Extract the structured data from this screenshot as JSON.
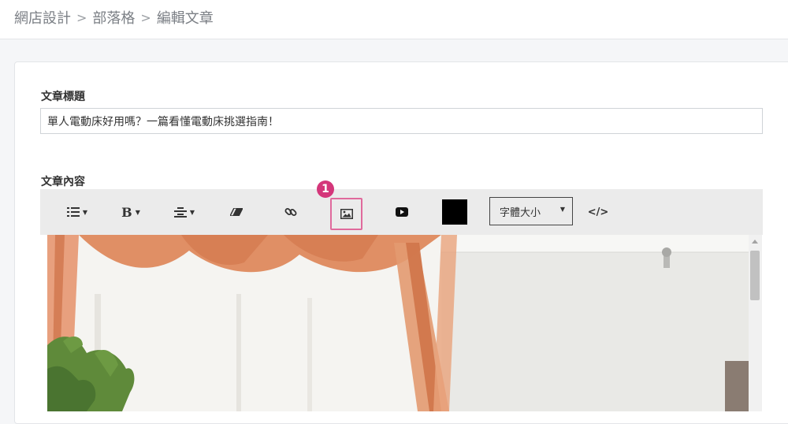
{
  "breadcrumb": {
    "items": [
      "網店設計",
      "部落格",
      "編輯文章"
    ],
    "separator": ">"
  },
  "form": {
    "title_label": "文章標題",
    "title_value": "單人電動床好用嗎？一篇看懂電動床挑選指南！",
    "content_label": "文章內容"
  },
  "toolbar": {
    "list_icon": "unordered-list-icon",
    "bold_label": "B",
    "align_icon": "align-center-icon",
    "eraser_icon": "eraser-icon",
    "link_icon": "link-icon",
    "image_icon": "image-icon",
    "video_icon": "youtube-icon",
    "text_color": "#000000",
    "font_size_label": "字體大小",
    "code_label": "</>"
  },
  "annotation": {
    "step_number": "1",
    "highlight_color": "#e06a9c"
  },
  "editor": {
    "image_description": "bedroom-photo"
  }
}
